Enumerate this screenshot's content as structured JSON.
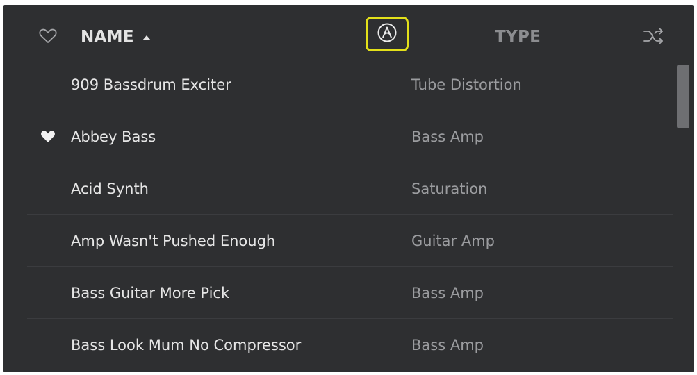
{
  "header": {
    "name_label": "NAME",
    "type_label": "TYPE",
    "sort_direction": "ascending",
    "favorites_icon": "heart-outline-icon",
    "vendor_icon": "circle-a-logo-icon",
    "shuffle_icon": "shuffle-icon"
  },
  "presets": [
    {
      "name": "909 Bassdrum Exciter",
      "type": "Tube Distortion",
      "favorite": false
    },
    {
      "name": "Abbey Bass",
      "type": "Bass Amp",
      "favorite": true
    },
    {
      "name": "Acid Synth",
      "type": "Saturation",
      "favorite": false
    },
    {
      "name": "Amp Wasn't Pushed Enough",
      "type": "Guitar Amp",
      "favorite": false
    },
    {
      "name": "Bass Guitar More Pick",
      "type": "Bass Amp",
      "favorite": false
    },
    {
      "name": "Bass Look Mum No Compressor",
      "type": "Bass Amp",
      "favorite": false
    }
  ],
  "colors": {
    "background": "#2e2f31",
    "highlight": "#e3e01a",
    "text_primary": "#e6e6e6",
    "text_secondary": "#9b9c9f"
  }
}
